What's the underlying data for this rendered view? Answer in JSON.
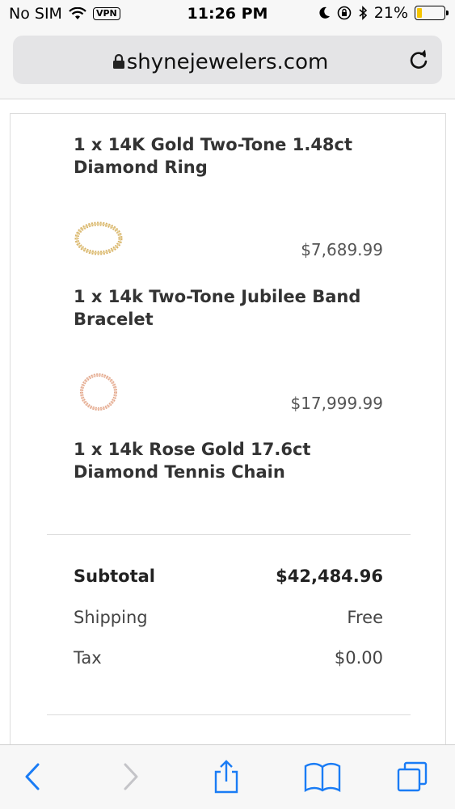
{
  "status_bar": {
    "carrier": "No SIM",
    "vpn": "VPN",
    "time": "11:26 PM",
    "battery": "21%",
    "battery_level": 0.21,
    "battery_color": "#f5c400"
  },
  "browser": {
    "url": "shynejewelers.com",
    "icons": [
      "lock-icon",
      "reload-icon",
      "back-icon",
      "forward-icon",
      "share-icon",
      "bookmarks-icon",
      "tabs-icon"
    ],
    "accent": "#1a7cf5"
  },
  "order": {
    "items": [
      {
        "title": "1 x 14K Gold Two-Tone 1.48ct Diamond Ring"
      },
      {
        "price": "$7,689.99",
        "title": "1 x 14k Two-Tone Jubilee Band Bracelet",
        "thumb": "gold-bracelet-image"
      },
      {
        "price": "$17,999.99",
        "title": "1 x 14k Rose Gold 17.6ct Diamond Tennis Chain",
        "thumb": "rose-gold-chain-image"
      }
    ],
    "summary": {
      "subtotal_label": "Subtotal",
      "subtotal_value": "$42,484.96",
      "shipping_label": "Shipping",
      "shipping_value": "Free",
      "tax_label": "Tax",
      "tax_value": "$0.00"
    }
  }
}
